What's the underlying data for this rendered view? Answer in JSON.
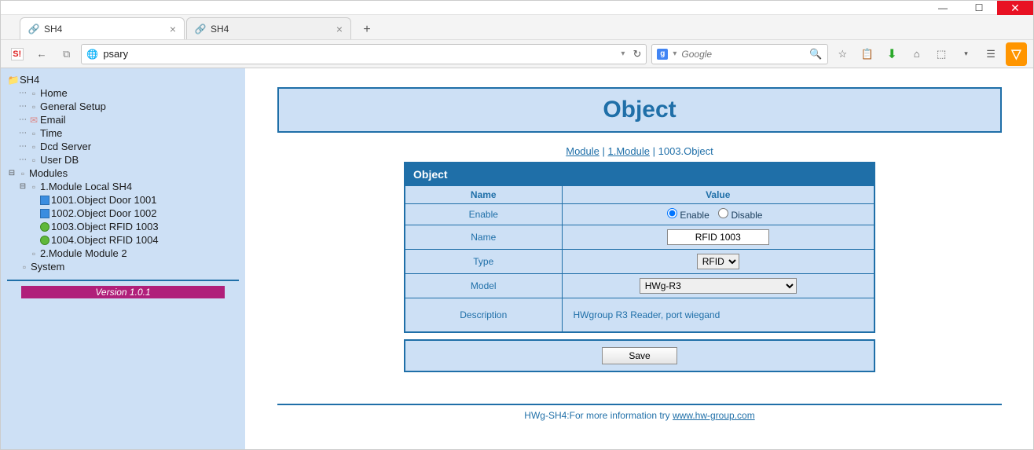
{
  "window": {
    "minimize": "—",
    "maximize": "☐",
    "close": "✕"
  },
  "tabs": [
    {
      "title": "SH4",
      "active": true
    },
    {
      "title": "SH4",
      "active": false
    }
  ],
  "url": "psary",
  "search": {
    "placeholder": "Google"
  },
  "sidebar": {
    "root": "SH4",
    "items": [
      "Home",
      "General Setup",
      "Email",
      "Time",
      "Dcd Server",
      "User DB"
    ],
    "modules_label": "Modules",
    "module1": {
      "label": "1.Module Local SH4",
      "children": [
        "1001.Object Door 1001",
        "1002.Object Door 1002",
        "1003.Object RFID 1003",
        "1004.Object RFID 1004"
      ]
    },
    "module2": "2.Module Module 2",
    "system": "System",
    "version": "Version 1.0.1"
  },
  "page": {
    "title": "Object",
    "breadcrumb": {
      "a": "Module",
      "b": "1.Module",
      "c": "1003.Object"
    },
    "table": {
      "section": "Object",
      "col_name": "Name",
      "col_value": "Value",
      "rows": {
        "enable": {
          "label": "Enable",
          "opt_enable": "Enable",
          "opt_disable": "Disable"
        },
        "name": {
          "label": "Name",
          "value": "RFID 1003"
        },
        "type": {
          "label": "Type",
          "value": "RFID"
        },
        "model": {
          "label": "Model",
          "value": "HWg-R3"
        },
        "desc": {
          "label": "Description",
          "value": "HWgroup R3 Reader, port wiegand"
        }
      }
    },
    "save": "Save",
    "footer_pre": "HWg-SH4:For more information try ",
    "footer_link": "www.hw-group.com"
  }
}
